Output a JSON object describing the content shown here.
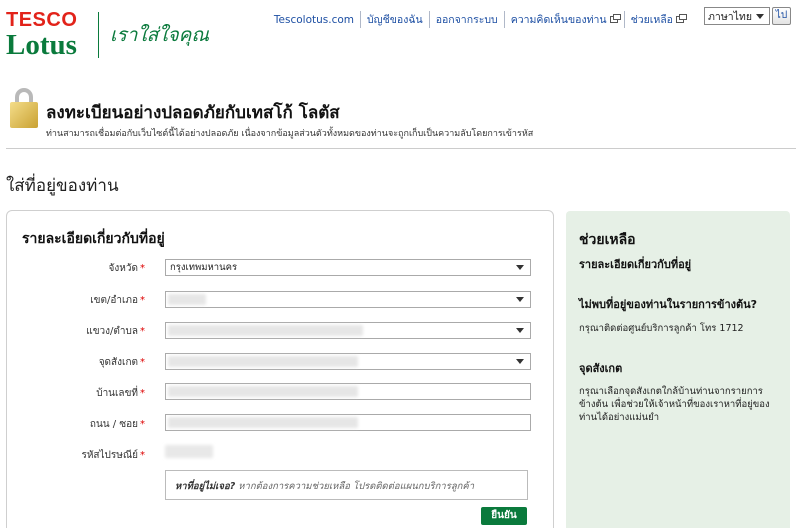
{
  "brand": {
    "line1": "TESCO",
    "line2": "Lotus",
    "tagline": "เราใส่ใจคุณ",
    "color_red": "#e2231a",
    "color_green": "#0a7a3c"
  },
  "topnav": [
    {
      "label": "Tescolotus.com",
      "icon": ""
    },
    {
      "label": "บัญชีของฉัน",
      "icon": ""
    },
    {
      "label": "ออกจากระบบ",
      "icon": ""
    },
    {
      "label": "ความคิดเห็นของท่าน",
      "icon": "external-window-icon"
    },
    {
      "label": "ช่วยเหลือ",
      "icon": "external-window-icon"
    }
  ],
  "language": {
    "selected": "ภาษาไทย",
    "go_label": "ไป"
  },
  "secure": {
    "title": "ลงทะเบียนอย่างปลอดภัยกับเทสโก้ โลตัส",
    "subtitle": "ท่านสามารถเชื่อมต่อกับเว็บไซต์นี้ได้อย่างปลอดภัย เนื่องจากข้อมูลส่วนตัวทั้งหมดของท่านจะถูกเก็บเป็นความลับโดยการเข้ารหัส"
  },
  "page_title": "ใส่ที่อยู่ของท่าน",
  "form": {
    "heading": "รายละเอียดเกี่ยวกับที่อยู่",
    "fields": {
      "province": {
        "label": "จังหวัด",
        "value": "กรุงเทพมหานคร"
      },
      "district": {
        "label": "เขต/อำเภอ",
        "value": ""
      },
      "subdistrict": {
        "label": "แขวง/ตำบล",
        "value": ""
      },
      "postcode_select": {
        "label": "จุดสังเกต",
        "value": ""
      },
      "house_no": {
        "label": "บ้านเลขที่",
        "value": ""
      },
      "road": {
        "label": "ถนน / ซอย",
        "value": ""
      },
      "zip": {
        "label": "รหัสไปรษณีย์",
        "value": ""
      }
    },
    "help_lead": "หาที่อยู่ไม่เจอ?",
    "help_text": "หากต้องการความช่วยเหลือ โปรดติดต่อแผนกบริการลูกค้า",
    "confirm_label": "ยืนยัน"
  },
  "help_panel": {
    "title": "ช่วยเหลือ",
    "subtitle": "รายละเอียดเกี่ยวกับที่อยู่",
    "question": "ไม่พบที่อยู่ของท่านในรายการข้างต้น?",
    "answer": "กรุณาติดต่อศูนย์บริการลูกค้า โทร 1712",
    "landmark_title": "จุดสังเกต",
    "landmark_text": "กรุณาเลือกจุดสังเกตใกล้บ้านท่านจากรายการข้างต้น เพื่อช่วยให้เจ้าหน้าที่ของเราหาที่อยู่ของท่านได้อย่างแม่นยำ"
  }
}
